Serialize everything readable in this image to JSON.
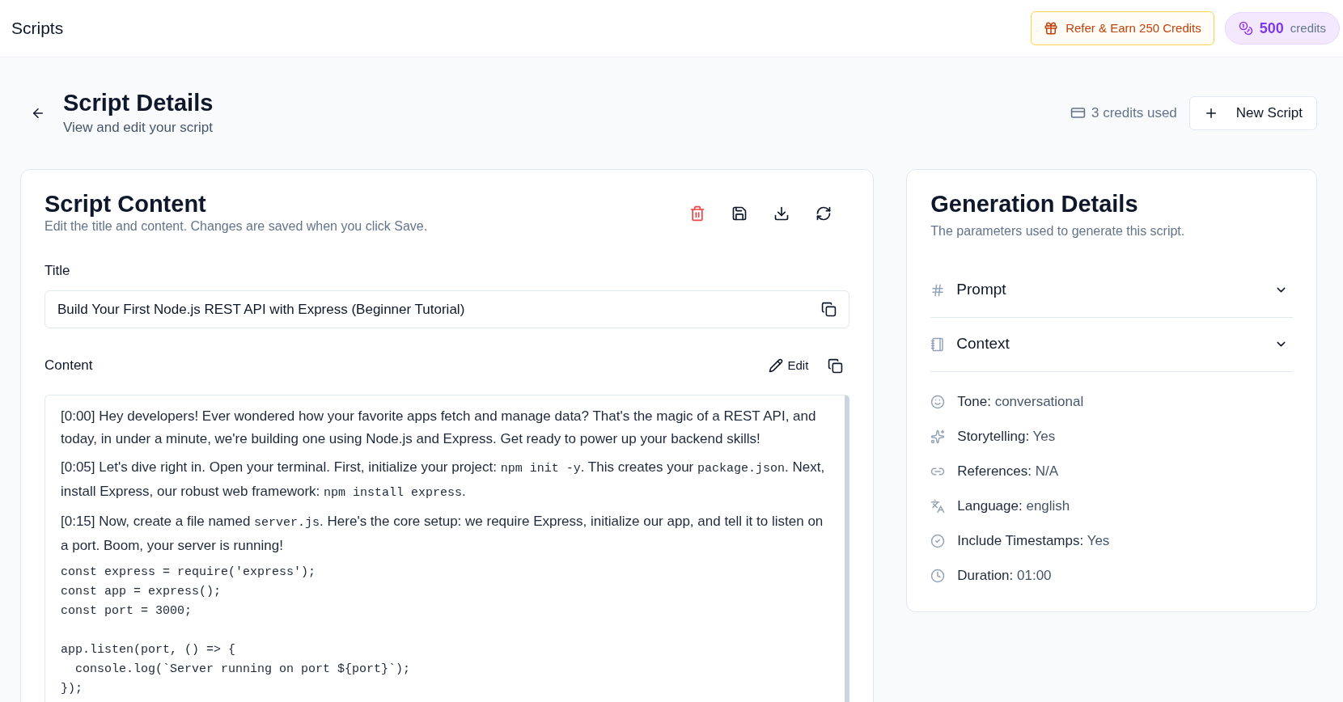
{
  "header": {
    "title": "Scripts",
    "refer_button": "Refer & Earn 250 Credits",
    "credits": {
      "amount": "500",
      "unit": "credits"
    }
  },
  "page": {
    "title": "Script Details",
    "subtitle": "View and edit your script",
    "credits_used": "3 credits used",
    "new_button": "New Script"
  },
  "script_content": {
    "title": "Script Content",
    "subtitle": "Edit the title and content. Changes are saved when you click Save.",
    "title_label": "Title",
    "title_value": "Build Your First Node.js REST API with Express (Beginner Tutorial)",
    "content_label": "Content",
    "edit_button": "Edit",
    "blocks": [
      {
        "kind": "paragraph",
        "segments": [
          {
            "kind": "text",
            "text": "[0:00] Hey developers! Ever wondered how your favorite apps fetch and manage data? That's the magic of a REST API, and today, in under a minute, we're building one using Node.js and Express. Get ready to power up your backend skills!"
          }
        ]
      },
      {
        "kind": "paragraph",
        "segments": [
          {
            "kind": "text",
            "text": "[0:05] Let's dive right in. Open your terminal. First, initialize your project: "
          },
          {
            "kind": "code",
            "text": "npm init -y"
          },
          {
            "kind": "text",
            "text": ". This creates your "
          },
          {
            "kind": "code",
            "text": "package.json"
          },
          {
            "kind": "text",
            "text": ". Next, install Express, our robust web framework: "
          },
          {
            "kind": "code",
            "text": "npm install express"
          },
          {
            "kind": "text",
            "text": "."
          }
        ]
      },
      {
        "kind": "paragraph",
        "segments": [
          {
            "kind": "text",
            "text": "[0:15] Now, create a file named "
          },
          {
            "kind": "code",
            "text": "server.js"
          },
          {
            "kind": "text",
            "text": ". Here's the core setup: we require Express, initialize our app, and tell it to listen on a port. Boom, your server is running!"
          }
        ]
      },
      {
        "kind": "code_block",
        "groups": [
          [
            "const express = require('express');",
            "const app = express();",
            "const port = 3000;"
          ],
          [
            "app.listen(port, () => {",
            "  console.log(`Server running on port ${port}`);",
            "});"
          ]
        ]
      }
    ]
  },
  "generation": {
    "title": "Generation Details",
    "subtitle": "The parameters used to generate this script.",
    "sections": [
      {
        "kind": "hash",
        "label": "Prompt",
        "expanded": false
      },
      {
        "kind": "book",
        "label": "Context",
        "expanded": false
      }
    ],
    "details": [
      {
        "kind": "smile",
        "label": "Tone:",
        "value": "conversational"
      },
      {
        "kind": "sparkle",
        "label": "Storytelling:",
        "value": "Yes"
      },
      {
        "kind": "link",
        "label": "References:",
        "value": "N/A"
      },
      {
        "kind": "language",
        "label": "Language:",
        "value": "english"
      },
      {
        "kind": "check",
        "label": "Include Timestamps:",
        "value": "Yes"
      },
      {
        "kind": "clock",
        "label": "Duration:",
        "value": "01:00"
      }
    ]
  }
}
